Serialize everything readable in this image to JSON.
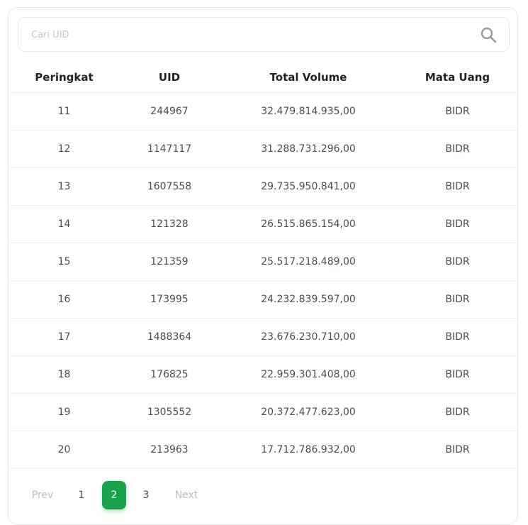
{
  "search": {
    "placeholder": "Cari UID"
  },
  "table": {
    "headers": [
      "Peringkat",
      "UID",
      "Total Volume",
      "Mata Uang"
    ],
    "rows": [
      [
        "11",
        "244967",
        "32.479.814.935,00",
        "BIDR"
      ],
      [
        "12",
        "1147117",
        "31.288.731.296,00",
        "BIDR"
      ],
      [
        "13",
        "1607558",
        "29.735.950.841,00",
        "BIDR"
      ],
      [
        "14",
        "121328",
        "26.515.865.154,00",
        "BIDR"
      ],
      [
        "15",
        "121359",
        "25.517.218.489,00",
        "BIDR"
      ],
      [
        "16",
        "173995",
        "24.232.839.597,00",
        "BIDR"
      ],
      [
        "17",
        "1488364",
        "23.676.230.710,00",
        "BIDR"
      ],
      [
        "18",
        "176825",
        "22.959.301.408,00",
        "BIDR"
      ],
      [
        "19",
        "1305552",
        "20.372.477.623,00",
        "BIDR"
      ],
      [
        "20",
        "213963",
        "17.712.786.932,00",
        "BIDR"
      ]
    ]
  },
  "pagination": {
    "prev_label": "Prev",
    "next_label": "Next",
    "pages": [
      "1",
      "2",
      "3"
    ],
    "current_page": "2",
    "accent_color": "#16a34a"
  }
}
